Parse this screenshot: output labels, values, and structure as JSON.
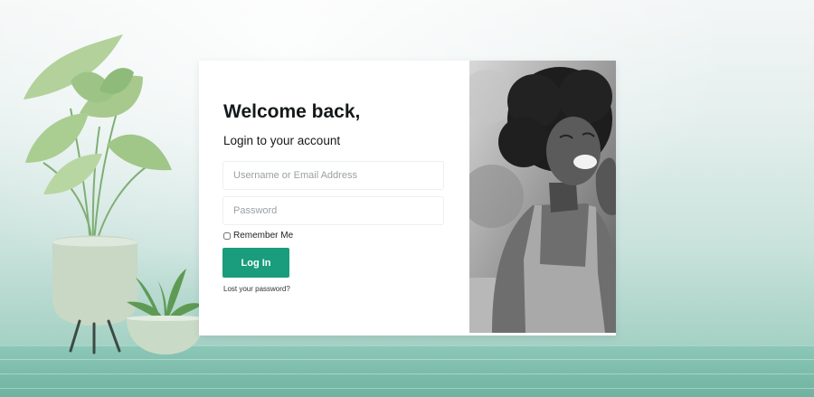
{
  "login": {
    "heading": "Welcome back,",
    "subheading": "Login to your account",
    "username_placeholder": "Username or Email Address",
    "password_placeholder": "Password",
    "remember_label": "Remember Me",
    "login_button": "Log In",
    "lost_password": "Lost your password?"
  },
  "colors": {
    "accent": "#1a9d7c",
    "background": "#c9e2dc",
    "card": "#ffffff"
  }
}
